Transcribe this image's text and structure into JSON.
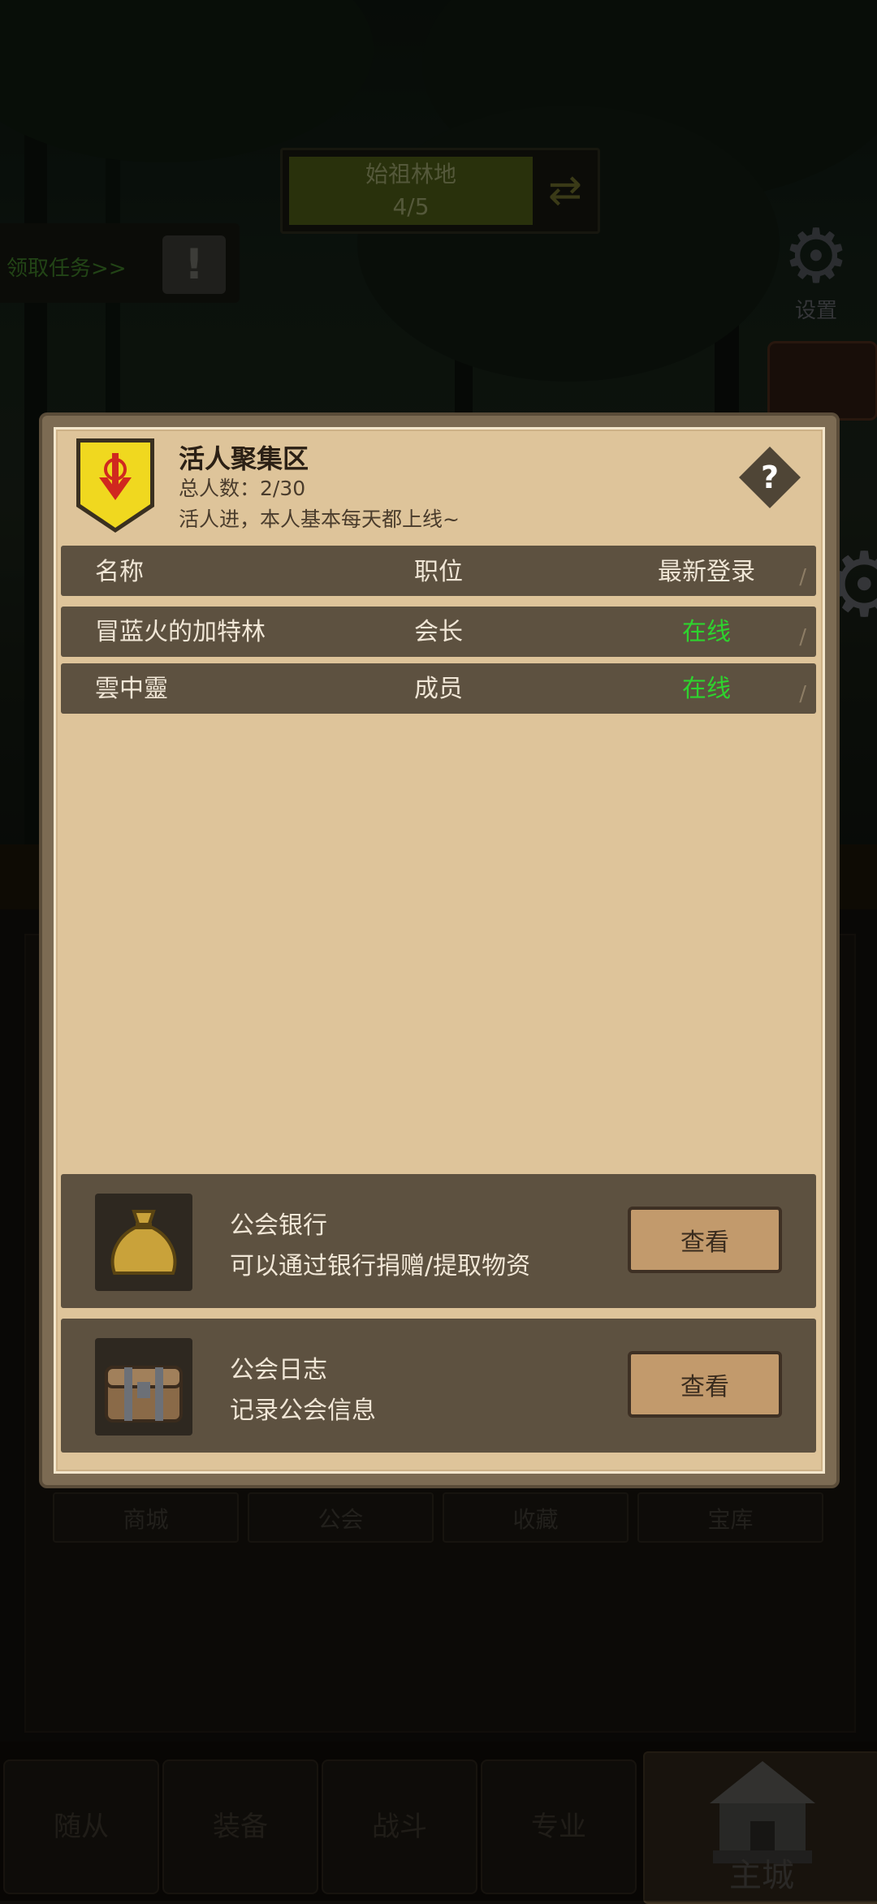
{
  "zone": {
    "name": "始祖林地",
    "progress": "4/5"
  },
  "quest": {
    "link": "领取任务>>"
  },
  "settings": {
    "label": "设置"
  },
  "tabs": [
    "商城",
    "公会",
    "收藏",
    "宝库"
  ],
  "bottom_nav": {
    "items": [
      "随从",
      "装备",
      "战斗",
      "专业"
    ],
    "main": "主城"
  },
  "guild": {
    "name": "活人聚集区",
    "count_label": "总人数：",
    "count_value": "2/30",
    "description": "活人进，本人基本每天都上线~"
  },
  "members_table": {
    "headers": [
      "名称",
      "职位",
      "最新登录"
    ],
    "rows": [
      {
        "name": "冒蓝火的加特林",
        "role": "会长",
        "status": "在线"
      },
      {
        "name": "雲中靈",
        "role": "成员",
        "status": "在线"
      }
    ]
  },
  "features": [
    {
      "title": "公会银行",
      "desc": "可以通过银行捐赠/提取物资",
      "button": "查看",
      "icon": "money-bag-icon"
    },
    {
      "title": "公会日志",
      "desc": "记录公会信息",
      "button": "查看",
      "icon": "treasure-chest-icon"
    }
  ],
  "colors": {
    "online": "#2ed32e",
    "panel": "#dec49a",
    "row": "#5d5140",
    "emblem": "#f0d81f"
  }
}
